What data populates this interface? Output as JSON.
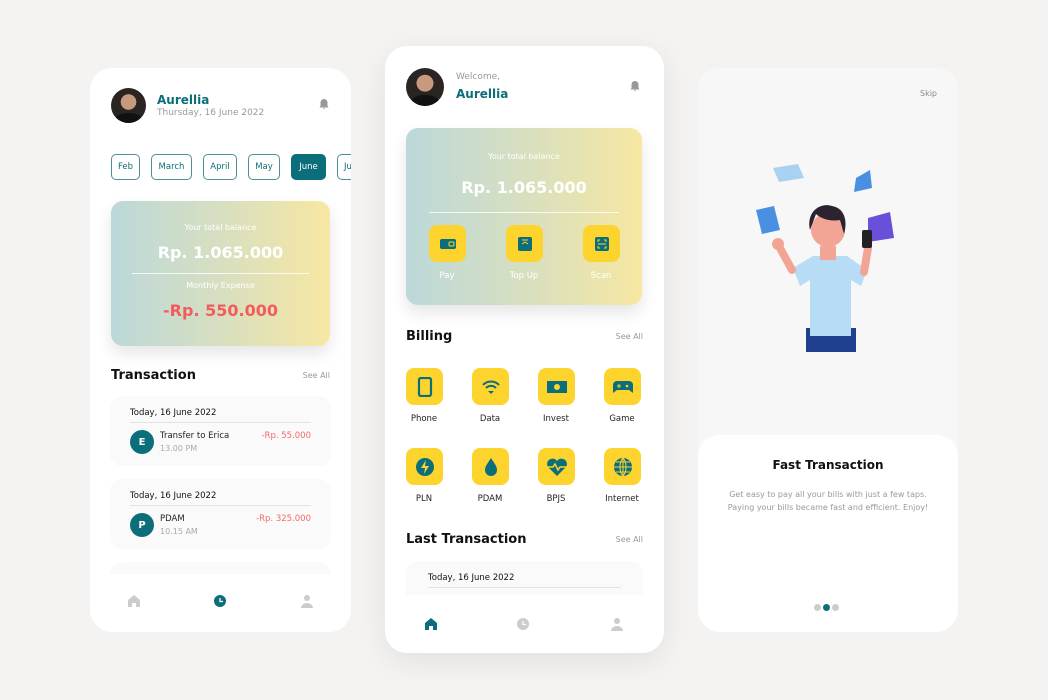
{
  "colors": {
    "primary": "#0b6e7a",
    "accent": "#fdd42e",
    "negative": "#f25c5c",
    "background": "#f4f3f1"
  },
  "screen1": {
    "user_name": "Aurellia",
    "date": "Thursday, 16 June 2022",
    "months": [
      "Feb",
      "March",
      "April",
      "May",
      "June",
      "Ju"
    ],
    "selected_month": "June",
    "card": {
      "balance_label": "Your total balance",
      "balance": "Rp. 1.065.000",
      "expense_label": "Monthly Expense",
      "expense": "-Rp. 550.000"
    },
    "section_title": "Transaction",
    "see_all": "See All",
    "transactions": [
      {
        "date": "Today, 16 June 2022",
        "initial": "E",
        "title": "Transfer to Erica",
        "time": "13.00 PM",
        "amount": "-Rp. 55.000"
      },
      {
        "date": "Today, 16 June 2022",
        "initial": "P",
        "title": "PDAM",
        "time": "10.15 AM",
        "amount": "-Rp. 325.000"
      }
    ],
    "nav": [
      "home-icon",
      "history-icon",
      "profile-icon"
    ],
    "active_nav": "history"
  },
  "screen2": {
    "welcome": "Welcome,",
    "user_name": "Aurellia",
    "card": {
      "balance_label": "Your total balance",
      "balance": "Rp. 1.065.000",
      "actions": [
        {
          "label": "Pay",
          "icon": "wallet-icon"
        },
        {
          "label": "Top Up",
          "icon": "top-up-icon"
        },
        {
          "label": "Scan",
          "icon": "scan-icon"
        }
      ]
    },
    "billing_title": "Billing",
    "see_all": "See All",
    "billing": [
      {
        "label": "Phone",
        "icon": "phone-icon"
      },
      {
        "label": "Data",
        "icon": "wifi-icon"
      },
      {
        "label": "Invest",
        "icon": "money-icon"
      },
      {
        "label": "Game",
        "icon": "gamepad-icon"
      },
      {
        "label": "PLN",
        "icon": "lightning-icon"
      },
      {
        "label": "PDAM",
        "icon": "water-drop-icon"
      },
      {
        "label": "BPJS",
        "icon": "heart-pulse-icon"
      },
      {
        "label": "Internet",
        "icon": "globe-icon"
      }
    ],
    "last_title": "Last Transaction",
    "last_see_all": "See All",
    "last_date": "Today, 16 June 2022",
    "active_nav": "home"
  },
  "screen3": {
    "skip": "Skip",
    "title": "Fast Transaction",
    "description": "Get easy to pay all your bills with just a few taps. Paying your bills became fast and efficient. Enjoy!",
    "page_index": 2,
    "page_count": 3
  }
}
